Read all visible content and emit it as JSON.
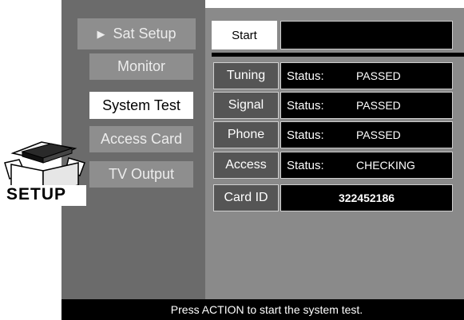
{
  "menu": {
    "items": [
      {
        "label": "Sat Setup",
        "selected": false
      },
      {
        "label": "Monitor",
        "selected": false
      },
      {
        "label": "System Test",
        "selected": true
      },
      {
        "label": "Access Card",
        "selected": false
      },
      {
        "label": "TV Output",
        "selected": false
      }
    ],
    "arrow_glyph": "▶"
  },
  "setup_icon": {
    "label": "SETUP",
    "icon": "receiver-box-icon"
  },
  "test_panel": {
    "start_label": "Start",
    "start_output": "",
    "rows": [
      {
        "label": "Tuning",
        "status_key": "Status:",
        "status_value": "PASSED"
      },
      {
        "label": "Signal",
        "status_key": "Status:",
        "status_value": "PASSED"
      },
      {
        "label": "Phone",
        "status_key": "Status:",
        "status_value": "PASSED"
      },
      {
        "label": "Access",
        "status_key": "Status:",
        "status_value": "CHECKING"
      }
    ],
    "card_id_label": "Card ID",
    "card_id_value": "322452186"
  },
  "hint": "Press ACTION to start the system test.",
  "colors": {
    "left_panel": "#6b6b6b",
    "right_panel": "#8a8a8a",
    "menu_item": "#8e8e8e",
    "selected": "#ffffff",
    "value_bg": "#000000"
  }
}
